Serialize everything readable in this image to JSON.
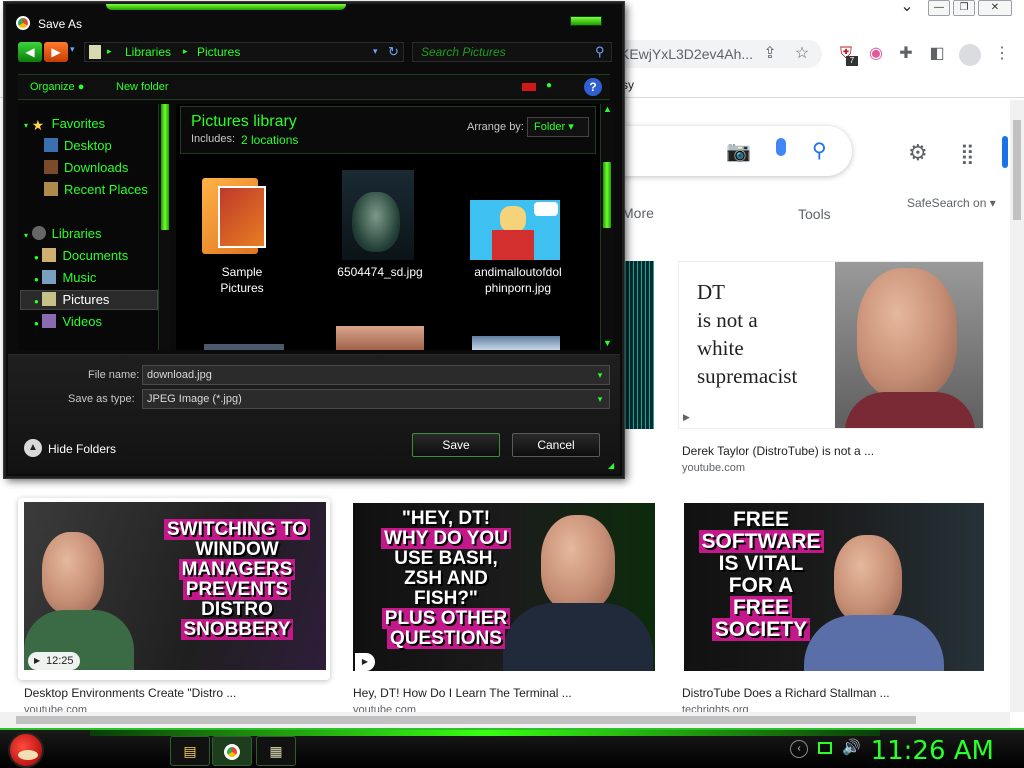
{
  "browser": {
    "url_fragment": "KEwjYxL3D2ev4Ah...",
    "bookmark_fragment": "sy",
    "extension_badge": "7",
    "win_min": "⌄",
    "win_restore": "❐",
    "win_close": "✕"
  },
  "results": {
    "tab_more": "More",
    "tab_tools": "Tools",
    "safesearch": "SafeSearch on",
    "cards": [
      {
        "title": "Derek Taylor (DistroTube) is not a ...",
        "source": "youtube.com",
        "overlay": [
          "DT",
          "is not a",
          "white",
          "supremacist"
        ]
      },
      {
        "title": "Desktop Environments Create \"Distro ...",
        "source": "youtube.com",
        "duration": "12:25",
        "overlay": [
          "SWITCHING TO",
          "WINDOW",
          "MANAGERS",
          "PREVENTS",
          "DISTRO",
          "SNOBBERY"
        ]
      },
      {
        "title": "Hey, DT! How Do I Learn The Terminal ...",
        "source": "youtube.com",
        "overlay": [
          "\"HEY, DT!",
          "WHY DO YOU",
          "USE BASH,",
          "ZSH AND",
          "FISH?\"",
          "PLUS OTHER",
          "QUESTIONS"
        ]
      },
      {
        "title": "DistroTube Does a Richard Stallman ...",
        "source": "techrights.org",
        "overlay": [
          "FREE",
          "SOFTWARE",
          "IS VITAL",
          "FOR A",
          "FREE",
          "SOCIETY"
        ]
      }
    ]
  },
  "dialog": {
    "title": "Save As",
    "breadcrumb": [
      "Libraries",
      "Pictures"
    ],
    "search_placeholder": "Search Pictures",
    "organize": "Organize",
    "new_folder": "New folder",
    "help": "?",
    "nav": {
      "favorites": "Favorites",
      "desktop": "Desktop",
      "downloads": "Downloads",
      "recent": "Recent Places",
      "libraries": "Libraries",
      "documents": "Documents",
      "music": "Music",
      "pictures": "Pictures",
      "videos": "Videos"
    },
    "library_title": "Pictures library",
    "includes_label": "Includes:",
    "includes_value": "2 locations",
    "arrange_label": "Arrange by:",
    "arrange_value": "Folder",
    "files": [
      {
        "name": "Sample\nPictures"
      },
      {
        "name": "6504474_sd.jpg"
      },
      {
        "name": "andimalloutofdol\nphinporn.jpg"
      }
    ],
    "file_name_label": "File name:",
    "file_name_value": "download.jpg",
    "save_type_label": "Save as type:",
    "save_type_value": "JPEG Image (*.jpg)",
    "hide_folders": "Hide Folders",
    "save_button": "Save",
    "cancel_button": "Cancel"
  },
  "taskbar": {
    "clock": "11:26 AM"
  },
  "colors": {
    "neon_green": "#29ff29",
    "dialog_bg": "#0b0b0b",
    "google_blue": "#1a73e8"
  }
}
